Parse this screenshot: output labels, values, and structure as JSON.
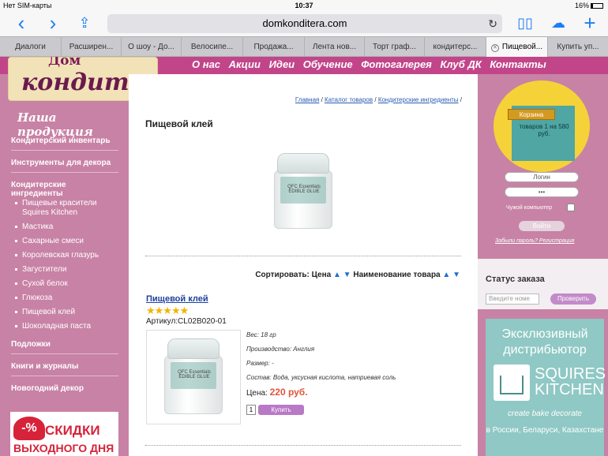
{
  "status": {
    "carrier": "Нет SIM-карты",
    "time": "10:37",
    "battery": "16%",
    "battery_level": 0.16
  },
  "browser": {
    "url": "domkonditera.com"
  },
  "tabs": [
    {
      "label": "Диалоги"
    },
    {
      "label": "Расширен..."
    },
    {
      "label": "О шоу - До..."
    },
    {
      "label": "Велосипе..."
    },
    {
      "label": "Продажа..."
    },
    {
      "label": "Лента нов..."
    },
    {
      "label": "Торт граф..."
    },
    {
      "label": "кондитерс..."
    },
    {
      "label": "Пищевой...",
      "active": true
    },
    {
      "label": "Купить уп..."
    }
  ],
  "site": {
    "logo_top": "Дом",
    "logo_bottom": "кондитера",
    "nav": [
      "О нас",
      "Акции",
      "Идеи",
      "Обучение",
      "Фотогалерея",
      "Клуб ДК",
      "Контакты"
    ]
  },
  "sidebar": {
    "title": "Наша продукция",
    "items": [
      "Кондитерский инвентарь",
      "Инструменты для декора",
      "Кондитерские ингредиенты"
    ],
    "subitems": [
      "Пищевые красители Squires Kitchen",
      "Мастика",
      "Сахарные смеси",
      "Королевская глазурь",
      "Загустители",
      "Сухой белок",
      "Глюкоза",
      "Пищевой клей",
      "Шоколадная паста"
    ],
    "items2": [
      "Подложки",
      "Книги и журналы",
      "Новогодний декор"
    ],
    "promo": {
      "pct": "-%",
      "line1": "СКИДКИ",
      "line2": "ВЫХОДНОГО ДНЯ"
    }
  },
  "breadcrumb": {
    "home": "Главная",
    "sep": " / ",
    "catalog": "Каталог товаров",
    "category": "Кондитерские ингредиенты",
    "tail": " /"
  },
  "main": {
    "title": "Пищевой клей",
    "jar_label": "QFC Essentials EDIBLE GLUE",
    "sort": {
      "label": "Сортировать: Цена",
      "name": "Наименование товара",
      "up": "▲",
      "down": "▼"
    },
    "product": {
      "name": "Пищевой клей",
      "rating": 5,
      "stars": "★★★★★",
      "sku": "Артикул:CL02B020-01",
      "specs": [
        "Вес: 18 гр",
        "Производство: Англия",
        "Размер: -",
        "Состав: Вода, уксусная кислота, натриевая соль"
      ],
      "price_label": "Цена:",
      "price": "220 руб.",
      "qty": "1",
      "buy": "Купить"
    }
  },
  "right": {
    "cart_badge": "Корзина",
    "cart_text": "товаров 1 на 580 руб.",
    "login_placeholder": "Логин",
    "password_value": "•••",
    "remember": "Чужой компьютер",
    "enter": "Войти",
    "forgot": "Забыли пароль? Регистрация",
    "order_title": "Статус заказа",
    "order_placeholder": "Введите номе",
    "order_btn": "Проверить",
    "banner_title": "Эксклюзивный дистрибьютор",
    "banner_brand": "SQUIRES KITCHEN",
    "banner_tagline": "create bake decorate",
    "banner_bottom": "в России, Беларуси, Казахстане"
  }
}
